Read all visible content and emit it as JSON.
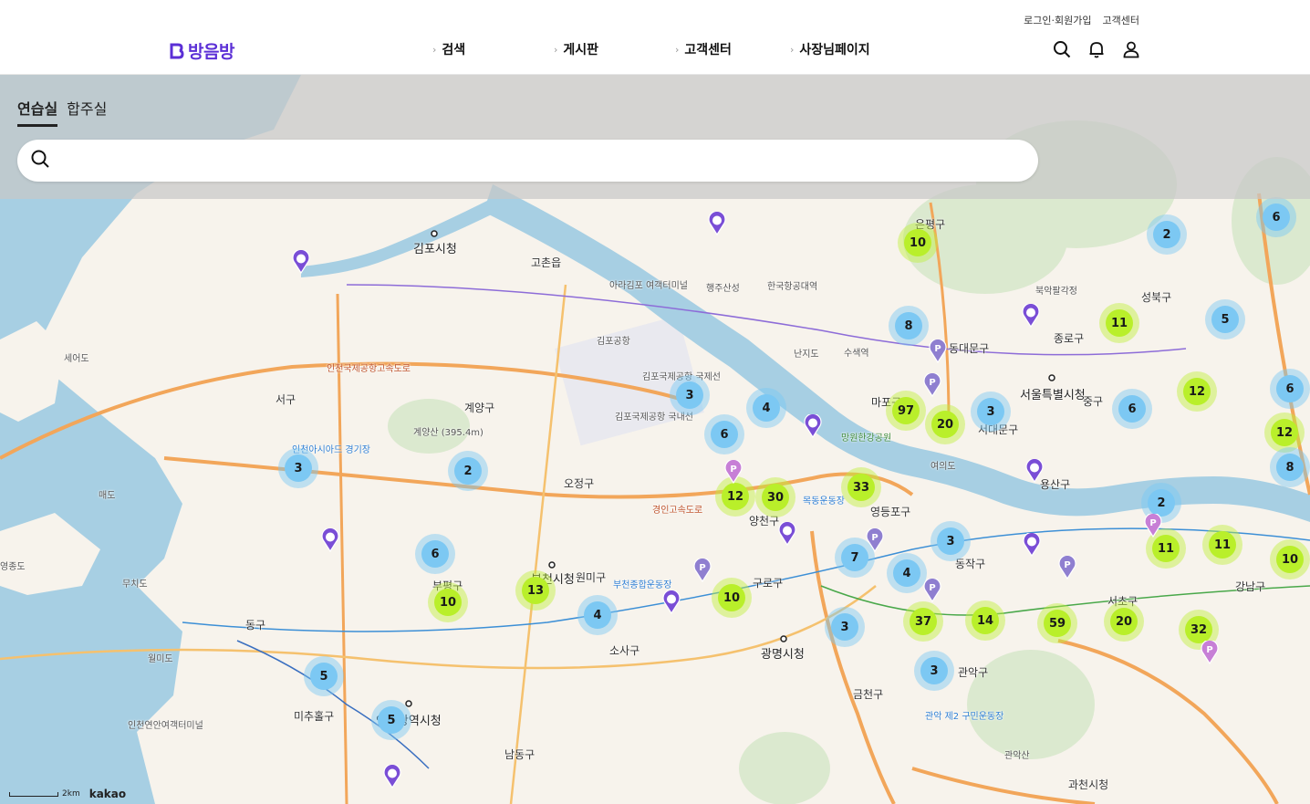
{
  "header": {
    "brand": "방음방",
    "top_links": [
      "로그인·회원가입",
      "고객센터"
    ],
    "nav": [
      "검색",
      "게시판",
      "고객센터",
      "사장님페이지"
    ],
    "icons": [
      "search-icon",
      "bell-icon",
      "user-icon"
    ]
  },
  "tabs": [
    "연습실",
    "합주실"
  ],
  "active_tab": "연습실",
  "search": {
    "placeholder": "",
    "value": ""
  },
  "map": {
    "attribution": "kakao",
    "scale": "2km",
    "labels": [
      "김포시청",
      "고촌읍",
      "아라김포 여객터미널",
      "김포공항",
      "김포국제공항 국제선",
      "김포국제공항 국내선",
      "계양구",
      "계양산 (395.4m)",
      "서구",
      "인천아시아드 경기장",
      "오정구",
      "부천시청",
      "원미구",
      "부평구",
      "동구",
      "미추홀구",
      "인천광역시청",
      "남동구",
      "소사구",
      "광명시청",
      "구로구",
      "양천구",
      "영등포구",
      "동작구",
      "금천구",
      "관악구",
      "관악산",
      "서울특별시청",
      "종로구",
      "성북구",
      "동대문구",
      "중구",
      "용산구",
      "마포구",
      "서대문구",
      "마포",
      "서초구",
      "강남구",
      "과천시청",
      "은평구",
      "북악팔각정",
      "인천국제공항고속도로",
      "경인고속도로",
      "월미도",
      "영종도",
      "세어도",
      "무치도",
      "매도",
      "목동운동장",
      "부천종합운동장",
      "관악 제2 구민운동장",
      "망원한강공원",
      "여의도",
      "한국항공대역",
      "수색역",
      "난지도",
      "행주산성",
      "인천연안여객터미널"
    ],
    "clusters": [
      {
        "n": 3,
        "c": "blue"
      },
      {
        "n": 2,
        "c": "blue"
      },
      {
        "n": 6,
        "c": "blue"
      },
      {
        "n": 10,
        "c": "green"
      },
      {
        "n": 13,
        "c": "green"
      },
      {
        "n": 4,
        "c": "blue"
      },
      {
        "n": 5,
        "c": "blue"
      },
      {
        "n": 5,
        "c": "blue"
      },
      {
        "n": 3,
        "c": "blue"
      },
      {
        "n": 4,
        "c": "blue"
      },
      {
        "n": 6,
        "c": "blue"
      },
      {
        "n": 12,
        "c": "green"
      },
      {
        "n": 30,
        "c": "green"
      },
      {
        "n": 10,
        "c": "green"
      },
      {
        "n": 10,
        "c": "green"
      },
      {
        "n": 8,
        "c": "blue"
      },
      {
        "n": 97,
        "c": "green"
      },
      {
        "n": 20,
        "c": "green"
      },
      {
        "n": 33,
        "c": "green"
      },
      {
        "n": 3,
        "c": "blue"
      },
      {
        "n": 7,
        "c": "blue"
      },
      {
        "n": 3,
        "c": "blue"
      },
      {
        "n": 4,
        "c": "blue"
      },
      {
        "n": 37,
        "c": "green"
      },
      {
        "n": 3,
        "c": "blue"
      },
      {
        "n": 3,
        "c": "blue"
      },
      {
        "n": 14,
        "c": "green"
      },
      {
        "n": 59,
        "c": "green"
      },
      {
        "n": 20,
        "c": "green"
      },
      {
        "n": 32,
        "c": "green"
      },
      {
        "n": 11,
        "c": "green"
      },
      {
        "n": 11,
        "c": "green"
      },
      {
        "n": 2,
        "c": "blue"
      },
      {
        "n": 2,
        "c": "blue"
      },
      {
        "n": 11,
        "c": "green"
      },
      {
        "n": 12,
        "c": "green"
      },
      {
        "n": 6,
        "c": "blue"
      },
      {
        "n": 5,
        "c": "blue"
      },
      {
        "n": 6,
        "c": "blue"
      },
      {
        "n": 6,
        "c": "blue"
      },
      {
        "n": 12,
        "c": "green"
      },
      {
        "n": 8,
        "c": "blue"
      },
      {
        "n": 10,
        "c": "green"
      }
    ]
  },
  "colors": {
    "brand": "#5b2fd6",
    "cluster_blue": "#7cc8f3",
    "cluster_green": "#b9ef2a",
    "water": "#a7cfe3",
    "road": "#f2a65a"
  }
}
